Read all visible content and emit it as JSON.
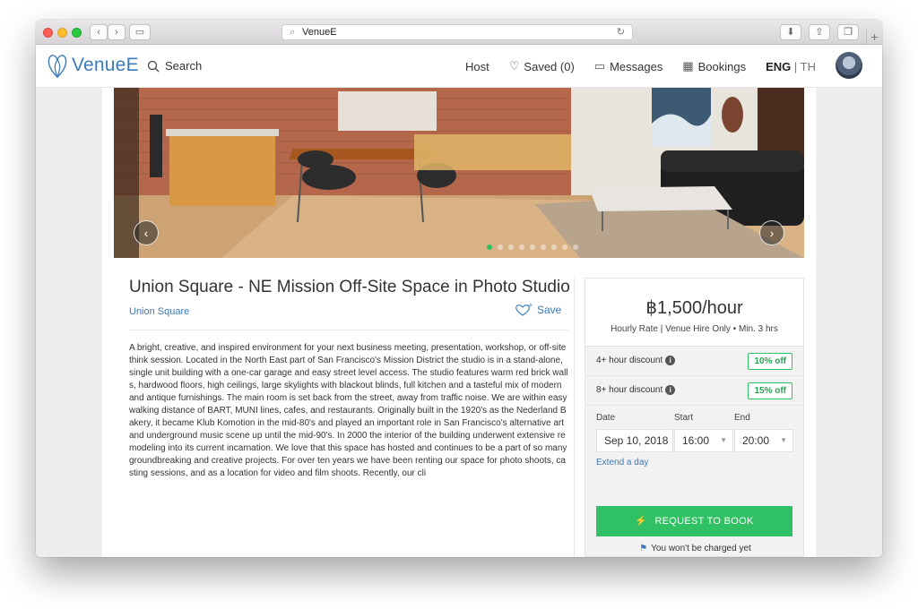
{
  "browser": {
    "url": "VenueE"
  },
  "nav": {
    "logo_text": "VenueE",
    "search_label": "Search",
    "host_label": "Host",
    "saved_label": "Saved (0)",
    "messages_label": "Messages",
    "bookings_label": "Bookings",
    "lang_active": "ENG",
    "lang_sep_other": " | TH"
  },
  "gallery": {
    "slide_count": 9,
    "active_slide": 1
  },
  "listing": {
    "title": "Union Square - NE Mission Off-Site Space in Photo Studio",
    "area": "Union Square",
    "save_label": "Save",
    "description": "A bright, creative, and inspired environment for your next business meeting, presentation, workshop, or off-site think session. Located in the North East part of San Francisco's Mission District the studio is in a stand-alone, single unit building with a one-car garage and easy street level access. The studio features warm red brick walls, hardwood floors, high ceilings, large skylights with blackout blinds, full kitchen and a tasteful mix of modern and antique furnishings. The main room is set back from the street, away from traffic noise. We are within easy walking distance of BART, MUNI lines, cafes, and restaurants.   Originally built in the 1920's as the Nederland Bakery, it became Klub Komotion in the mid-80's and played an important role in San Francisco's alternative art and underground music scene up until the mid-90's. In 2000 the interior of the building underwent extensive remodeling into its current incarnation. We love that this space has hosted and continues to be a part of so many groundbreaking and creative projects.   For over ten years we have been renting our space for photo shoots, casting sessions, and as a location for video and film shoots. Recently, our cli"
  },
  "booking": {
    "price": "฿1,500/hour",
    "price_sub": "Hourly Rate | Venue Hire Only • Min. 3 hrs",
    "discounts": [
      {
        "label": "4+ hour discount",
        "badge": "10% off"
      },
      {
        "label": "8+ hour discount",
        "badge": "15% off"
      }
    ],
    "date_label": "Date",
    "start_label": "Start",
    "end_label": "End",
    "date_value": "Sep 10, 2018",
    "start_value": "16:00",
    "end_value": "20:00",
    "extend_label": "Extend a day",
    "request_label": "REQUEST TO BOOK",
    "charged_note": "You won't be charged yet"
  },
  "colors": {
    "brand_blue": "#3a7bb8",
    "accent_green": "#2fc163"
  }
}
